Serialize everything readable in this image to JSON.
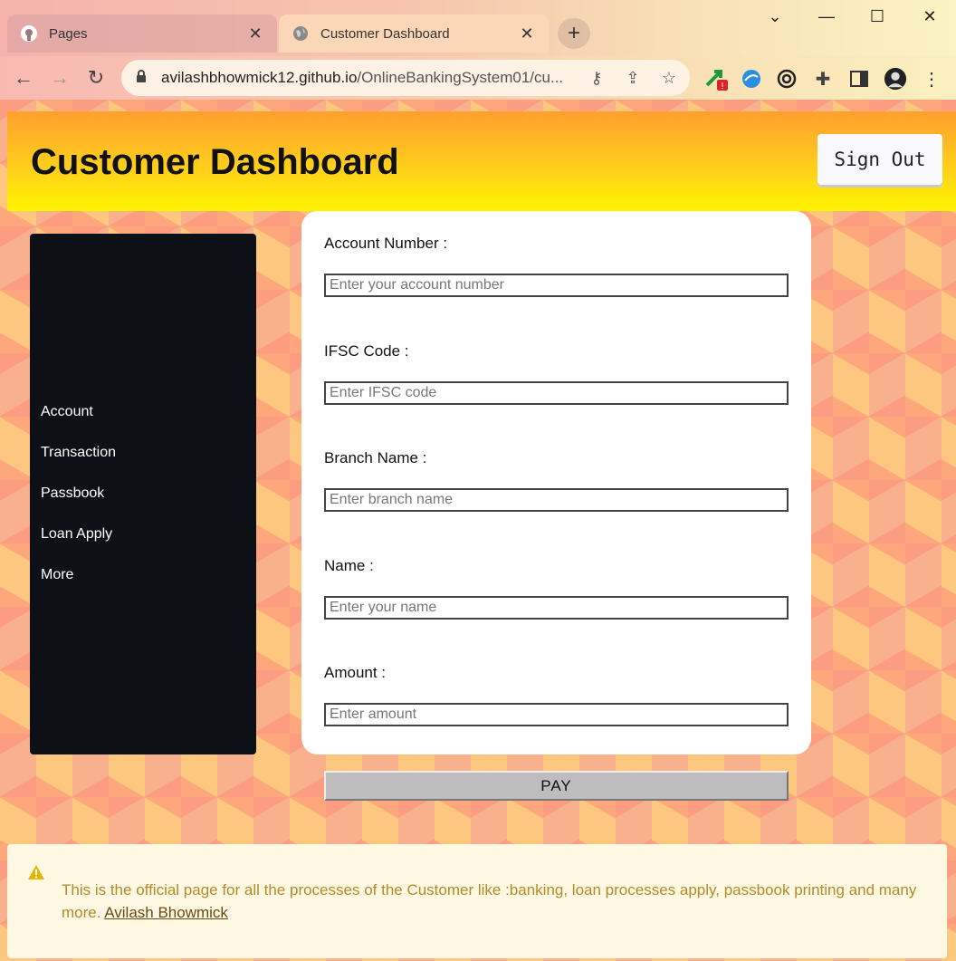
{
  "browser": {
    "tabs": [
      {
        "label": "Pages",
        "icon": "github-icon",
        "active": false
      },
      {
        "label": "Customer Dashboard",
        "icon": "globe-icon",
        "active": true
      }
    ],
    "url_host": "avilashbhowmick12.github.io",
    "url_path": "/OnlineBankingSystem01/cu...",
    "extension_badge": "!"
  },
  "header": {
    "title": "Customer Dashboard",
    "signout_label": "Sign Out"
  },
  "sidebar": {
    "items": [
      {
        "label": "Account"
      },
      {
        "label": "Transaction"
      },
      {
        "label": "Passbook"
      },
      {
        "label": "Loan Apply"
      },
      {
        "label": "More"
      }
    ]
  },
  "form": {
    "fields": [
      {
        "label": "Account Number :",
        "placeholder": "Enter your account number",
        "value": ""
      },
      {
        "label": "IFSC Code :",
        "placeholder": "Enter IFSC code",
        "value": ""
      },
      {
        "label": "Branch Name :",
        "placeholder": "Enter branch name",
        "value": ""
      },
      {
        "label": "Name :",
        "placeholder": "Enter your name",
        "value": ""
      },
      {
        "label": "Amount :",
        "placeholder": "Enter amount",
        "value": ""
      }
    ],
    "pay_label": "PAY"
  },
  "notice": {
    "text": "This is the official page for all the processes of the Customer like :banking, loan processes apply, passbook printing and many more. ",
    "link_text": "Avilash Bhowmick"
  },
  "colors": {
    "header_top": "#ff9f2f",
    "header_bottom": "#fff400",
    "sidebar": "#0d1016",
    "notice_bg": "#fff8e3",
    "notice_text": "#b48a2a"
  }
}
